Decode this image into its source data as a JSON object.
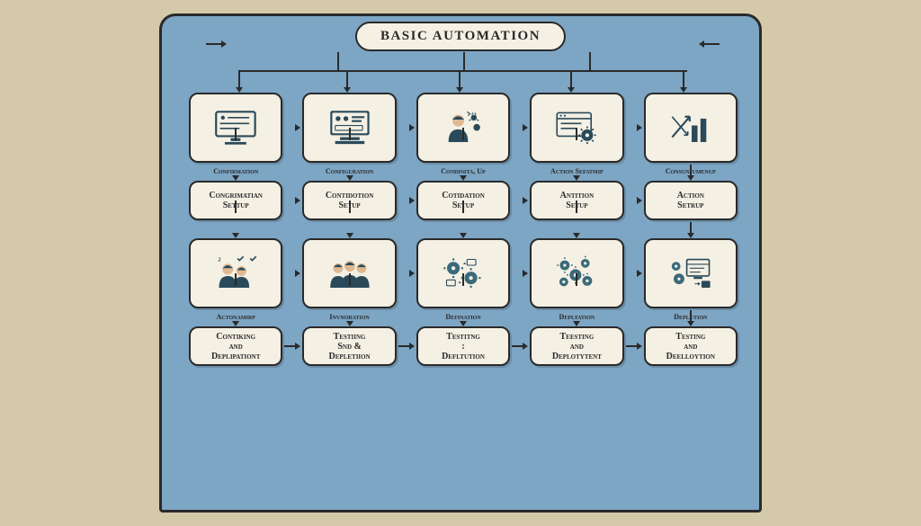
{
  "title": "BASIC AUTOMATION",
  "row1": [
    {
      "caption": "Confirmation",
      "icon": "monitor"
    },
    {
      "caption": "Configuration",
      "icon": "monitor-dash"
    },
    {
      "caption": "Condinita, Up",
      "icon": "person-gears"
    },
    {
      "caption": "Action Sefatmip",
      "icon": "browser-gear"
    },
    {
      "caption": "Consunjumenup",
      "icon": "chart-arrow"
    }
  ],
  "row1_labels": [
    "Congrimatian\nSettup",
    "Contidotion\nSetup",
    "Cotidation\nSetup",
    "Antition\nSetup",
    "Action\nSetrup"
  ],
  "row2": [
    {
      "caption": "Actonamirp",
      "icon": "people-check"
    },
    {
      "caption": "Invnoration",
      "icon": "people-three"
    },
    {
      "caption": "Defination",
      "icon": "gears-swap"
    },
    {
      "caption": "Depltation",
      "icon": "gears-five"
    },
    {
      "caption": "Deplution",
      "icon": "monitor-gears"
    }
  ],
  "row2_labels": [
    "Contiking\nand\nDeplipationt",
    "Testiing\nSnd &\nDepletiion",
    "Testitng\n:\nDefltution",
    "Teesting\nand\nDeplotytent",
    "Testing\nand\nDeelloytion"
  ]
}
